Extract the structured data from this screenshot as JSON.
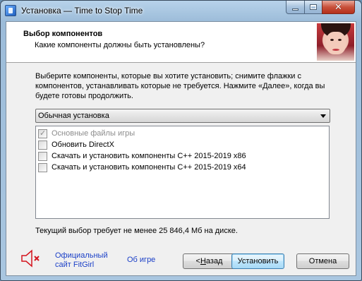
{
  "window": {
    "title": "Установка — Time to Stop Time"
  },
  "header": {
    "title": "Выбор компонентов",
    "subtitle": "Какие компоненты должны быть установлены?"
  },
  "description": "Выберите компоненты, которые вы хотите установить; снимите флажки с компонентов, устанавливать которые не требуется. Нажмите «Далее», когда вы будете готовы продолжить.",
  "install_type": {
    "selected": "Обычная установка"
  },
  "components": [
    {
      "label": "Основные файлы игры",
      "checked": true,
      "disabled": true
    },
    {
      "label": "Обновить DirectX",
      "checked": false,
      "disabled": false
    },
    {
      "label": "Скачать и установить компоненты C++ 2015-2019 x86",
      "checked": false,
      "disabled": false
    },
    {
      "label": "Скачать и установить компоненты C++ 2015-2019 x64",
      "checked": false,
      "disabled": false
    }
  ],
  "disk_requirement": "Текущий выбор требует не менее 25 846,4 Мб на диске.",
  "footer": {
    "sound_icon": "speaker-muted-icon",
    "fitgirl_line1": "Официальный",
    "fitgirl_line2": "сайт FitGirl",
    "about_link": "Об игре"
  },
  "buttons": {
    "back_prefix": "< ",
    "back_accel": "Н",
    "back_rest": "азад",
    "install": "Установить",
    "cancel": "Отмена"
  },
  "colors": {
    "link": "#1a3fc7",
    "mute_x": "#d4141e",
    "close_button": "#c8513c"
  }
}
